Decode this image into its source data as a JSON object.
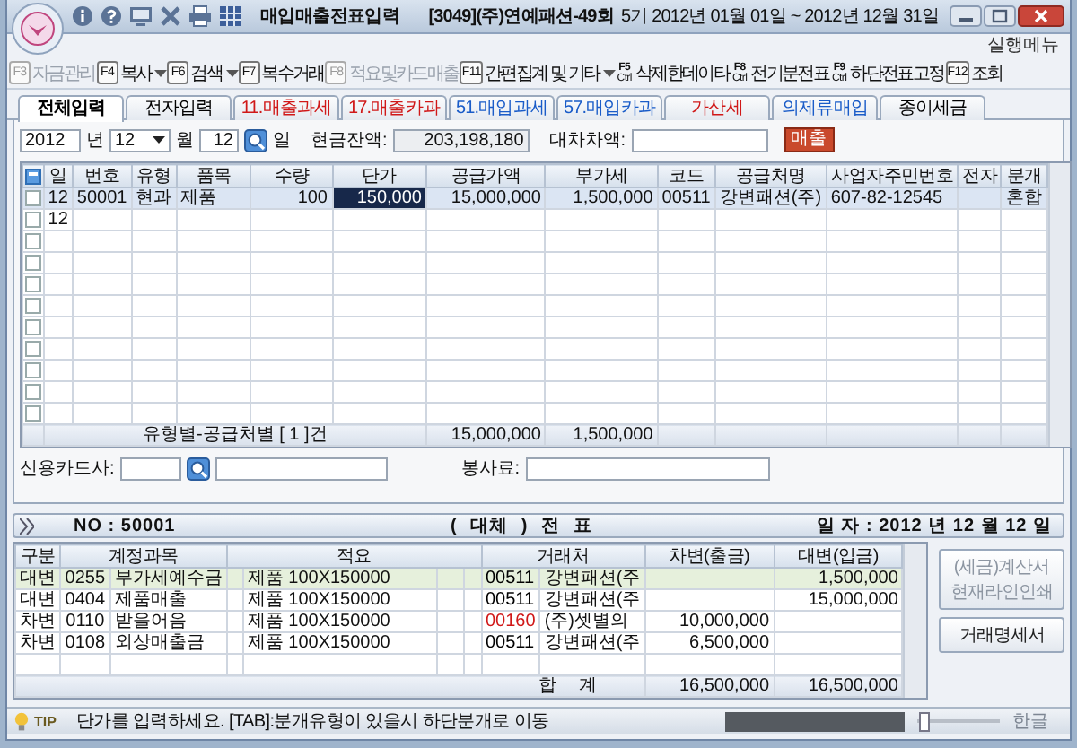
{
  "window": {
    "title": "매입매출전표입력",
    "company": "[3049](주)연예패션-49회",
    "period": "5기 2012년 01월 01일 ~ 2012년 12월 31일"
  },
  "menu_link": "실행메뉴",
  "toolbar": [
    {
      "key": "F3",
      "label": "자금관리",
      "disabled": true,
      "menu": false
    },
    {
      "key": "F4",
      "label": "복사",
      "disabled": false,
      "menu": true
    },
    {
      "key": "F6",
      "label": "검색",
      "disabled": false,
      "menu": true
    },
    {
      "key": "F7",
      "label": "복수거래",
      "disabled": false,
      "menu": false
    },
    {
      "key": "F8",
      "label": "적요및카드매출",
      "disabled": true,
      "menu": false
    },
    {
      "key": "F11",
      "label": "간편집계 및 기타",
      "disabled": false,
      "menu": true
    },
    {
      "key": "F5",
      "mod": "Ctrl",
      "label": "삭제한데이타",
      "disabled": false,
      "menu": false
    },
    {
      "key": "F8",
      "mod": "Ctrl",
      "label": "전기분전표",
      "disabled": false,
      "menu": false
    },
    {
      "key": "F9",
      "mod": "Ctrl",
      "label": "하단전표고정",
      "disabled": false,
      "menu": false
    },
    {
      "key": "F12",
      "label": "조회",
      "disabled": false,
      "menu": false
    }
  ],
  "tabs": [
    {
      "label": "전체입력",
      "selected": true,
      "color": "#000000"
    },
    {
      "label": "전자입력",
      "selected": false,
      "color": "#000000"
    },
    {
      "label": "11.매출과세",
      "selected": false,
      "color": "#d01818"
    },
    {
      "label": "17.매출카과",
      "selected": false,
      "color": "#d01818"
    },
    {
      "label": "51.매입과세",
      "selected": false,
      "color": "#1a5cc8"
    },
    {
      "label": "57.매입카과",
      "selected": false,
      "color": "#1a5cc8"
    },
    {
      "label": "가산세",
      "selected": false,
      "color": "#d01818"
    },
    {
      "label": "의제류매입",
      "selected": false,
      "color": "#1a5cc8"
    },
    {
      "label": "종이세금",
      "selected": false,
      "color": "#000000"
    }
  ],
  "date_bar": {
    "year": "2012",
    "year_label": "년",
    "month": "12",
    "month_label": "월",
    "day": "12",
    "day_label": "일",
    "cash_label": "현금잔액:",
    "cash": "203,198,180",
    "diff_label": "대차차액:",
    "type_button": "매출"
  },
  "grid": {
    "columns": [
      {
        "label": "일",
        "kind": "text"
      },
      {
        "label": "번호",
        "kind": "text"
      },
      {
        "label": "유형",
        "kind": "text"
      },
      {
        "label": "품목",
        "kind": "text"
      },
      {
        "label": "수량",
        "kind": "number"
      },
      {
        "label": "단가",
        "kind": "number"
      },
      {
        "label": "공급가액",
        "kind": "number"
      },
      {
        "label": "부가세",
        "kind": "number"
      },
      {
        "label": "코드",
        "kind": "text"
      },
      {
        "label": "공급처명",
        "kind": "text"
      },
      {
        "label": "사업자주민번호",
        "kind": "text"
      },
      {
        "label": "전자",
        "kind": "text"
      },
      {
        "label": "분개",
        "kind": "text"
      }
    ],
    "rows": [
      {
        "checked": false,
        "selected": true,
        "day": "12",
        "no": "50001",
        "type": "현과",
        "item": "제품",
        "qty": "100",
        "price": {
          "text": "150,000",
          "editing": true
        },
        "supply": "15,000,000",
        "vat": "1,500,000",
        "code": "00511",
        "vendor": "강변패션(주)",
        "bizno": "607-82-12545",
        "entry": "혼합"
      },
      {
        "checked": false,
        "selected": false,
        "day": "12"
      },
      {
        "checked": false,
        "selected": false
      },
      {
        "checked": false,
        "selected": false
      },
      {
        "checked": false,
        "selected": false
      },
      {
        "checked": false,
        "selected": false
      },
      {
        "checked": false,
        "selected": false
      },
      {
        "checked": false,
        "selected": false
      },
      {
        "checked": false,
        "selected": false
      },
      {
        "checked": false,
        "selected": false
      },
      {
        "checked": false,
        "selected": false
      }
    ],
    "summary": {
      "label": "유형별-공급처별 [ 1 ]건",
      "supply": "15,000,000",
      "vat": "1,500,000"
    }
  },
  "card_row": {
    "card_label": "신용카드사:",
    "service_label": "봉사료:"
  },
  "voucher": {
    "number": "NO : 50001",
    "type": "( 대체 ) 전 표",
    "date": "일 자 : 2012 년 12 월 12 일",
    "columns": [
      "구분",
      "계정과목",
      "적요",
      "거래처",
      "차변(출금)",
      "대변(입금)"
    ],
    "rows": [
      {
        "selected": true,
        "side": "대변",
        "acct_code": "0255",
        "acct_name": "부가세예수금",
        "memo": "제품 100X150000",
        "partner": {
          "code": "00511",
          "name": "강변패션(주",
          "color": "#000000"
        },
        "credit": "1,500,000"
      },
      {
        "selected": false,
        "side": "대변",
        "acct_code": "0404",
        "acct_name": "제품매출",
        "memo": "제품 100X150000",
        "partner": {
          "code": "00511",
          "name": "강변패션(주",
          "color": "#000000"
        },
        "credit": "15,000,000"
      },
      {
        "selected": false,
        "side": "차변",
        "acct_code": "0110",
        "acct_name": "받을어음",
        "memo": "제품 100X150000",
        "partner": {
          "code": "00160",
          "name": "(주)셋별의",
          "color": "#d01818"
        },
        "debit": "10,000,000"
      },
      {
        "selected": false,
        "side": "차변",
        "acct_code": "0108",
        "acct_name": "외상매출금",
        "memo": "제품 100X150000",
        "partner": {
          "code": "00511",
          "name": "강변패션(주",
          "color": "#000000"
        },
        "debit": "6,500,000"
      },
      {
        "selected": false
      }
    ],
    "total_label": "합 계",
    "total_debit": "16,500,000",
    "total_credit": "16,500,000"
  },
  "side_buttons": [
    {
      "lines": [
        "(세금)계산서",
        "현재라인인쇄"
      ],
      "disabled": true
    },
    {
      "lines": [
        "거래명세서"
      ],
      "disabled": false
    }
  ],
  "status_bar": {
    "tip": "TIP",
    "message": "단가를 입력하세요.  [TAB]:분개유형이 있을시 하단분개로 이동",
    "zoom": {
      "level": 0.03
    },
    "ime": "한글"
  }
}
